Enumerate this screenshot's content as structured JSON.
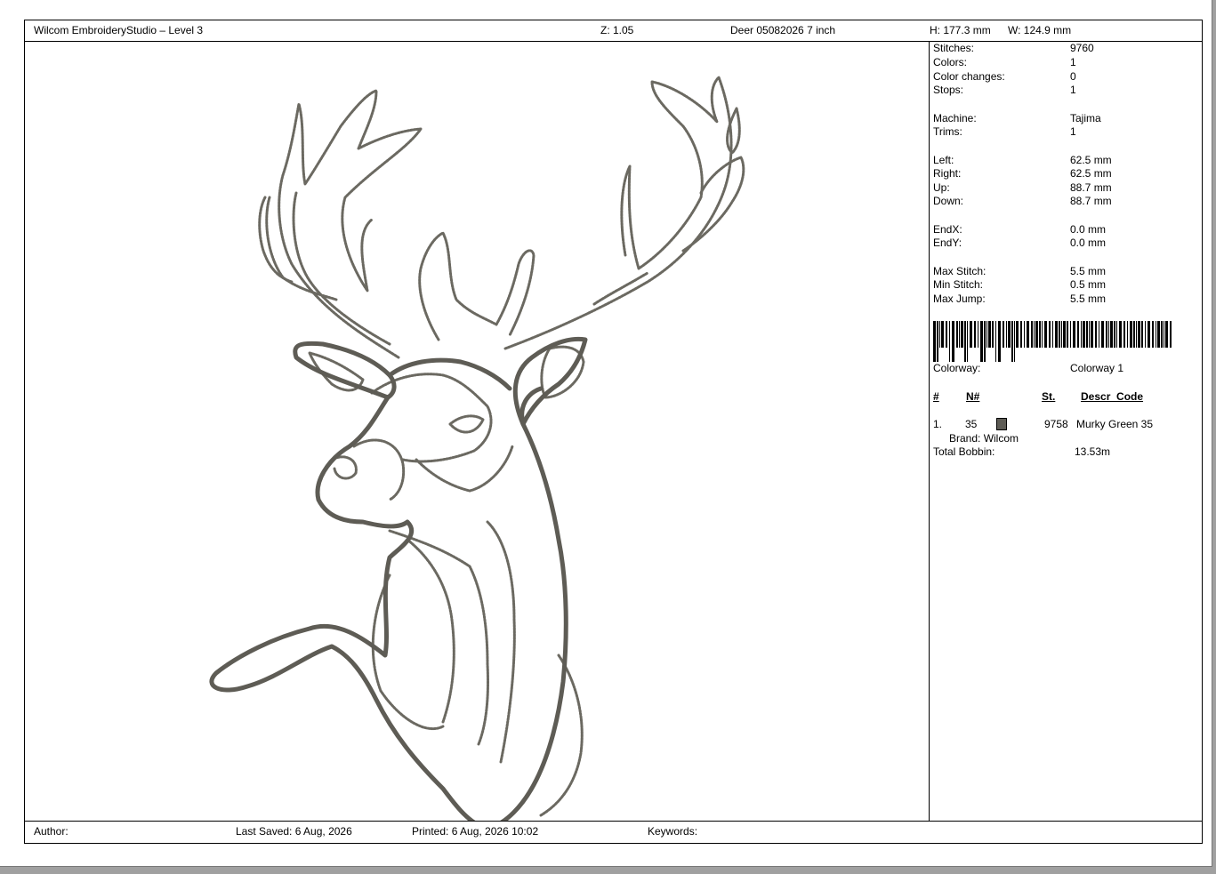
{
  "header": {
    "app_title": "Wilcom EmbroideryStudio – Level 3",
    "zoom": "Z: 1.05",
    "design_name": "Deer 05082026 7 inch",
    "height": "H: 177.3 mm",
    "width": "W: 124.9 mm"
  },
  "design": {
    "thread_color": "#5e5c55",
    "outline_color": "#6b6961"
  },
  "info": {
    "stitches_label": "Stitches:",
    "stitches": "9760",
    "colors_label": "Colors:",
    "colors": "1",
    "color_changes_label": "Color changes:",
    "color_changes": "0",
    "stops_label": "Stops:",
    "stops": "1",
    "machine_label": "Machine:",
    "machine": "Tajima",
    "trims_label": "Trims:",
    "trims": "1",
    "left_label": "Left:",
    "left": "62.5 mm",
    "right_label": "Right:",
    "right": "62.5 mm",
    "up_label": "Up:",
    "up": "88.7 mm",
    "down_label": "Down:",
    "down": "88.7 mm",
    "endx_label": "EndX:",
    "endx": "0.0 mm",
    "endy_label": "EndY:",
    "endy": "0.0 mm",
    "max_stitch_label": "Max Stitch:",
    "max_stitch": "5.5 mm",
    "min_stitch_label": "Min Stitch:",
    "min_stitch": "0.5 mm",
    "max_jump_label": "Max Jump:",
    "max_jump": "5.5 mm",
    "colorway_label": "Colorway:",
    "colorway": "Colorway 1"
  },
  "thread_table": {
    "headers": {
      "num": "#",
      "n": "N#",
      "st": "St.",
      "descr": "Descr_Code"
    },
    "rows": [
      {
        "num": "1.",
        "n": "35",
        "swatch": "#5e5c55",
        "st": "9758",
        "descr": "Murky Green 35"
      }
    ],
    "brand": "Brand: Wilcom",
    "bobbin_label": "Total Bobbin:",
    "bobbin": "13.53m"
  },
  "footer": {
    "author_label": "Author:",
    "last_saved": "Last Saved:  6 Aug, 2026",
    "printed": "Printed:  6 Aug, 2026 10:02",
    "keywords_label": "Keywords:"
  }
}
